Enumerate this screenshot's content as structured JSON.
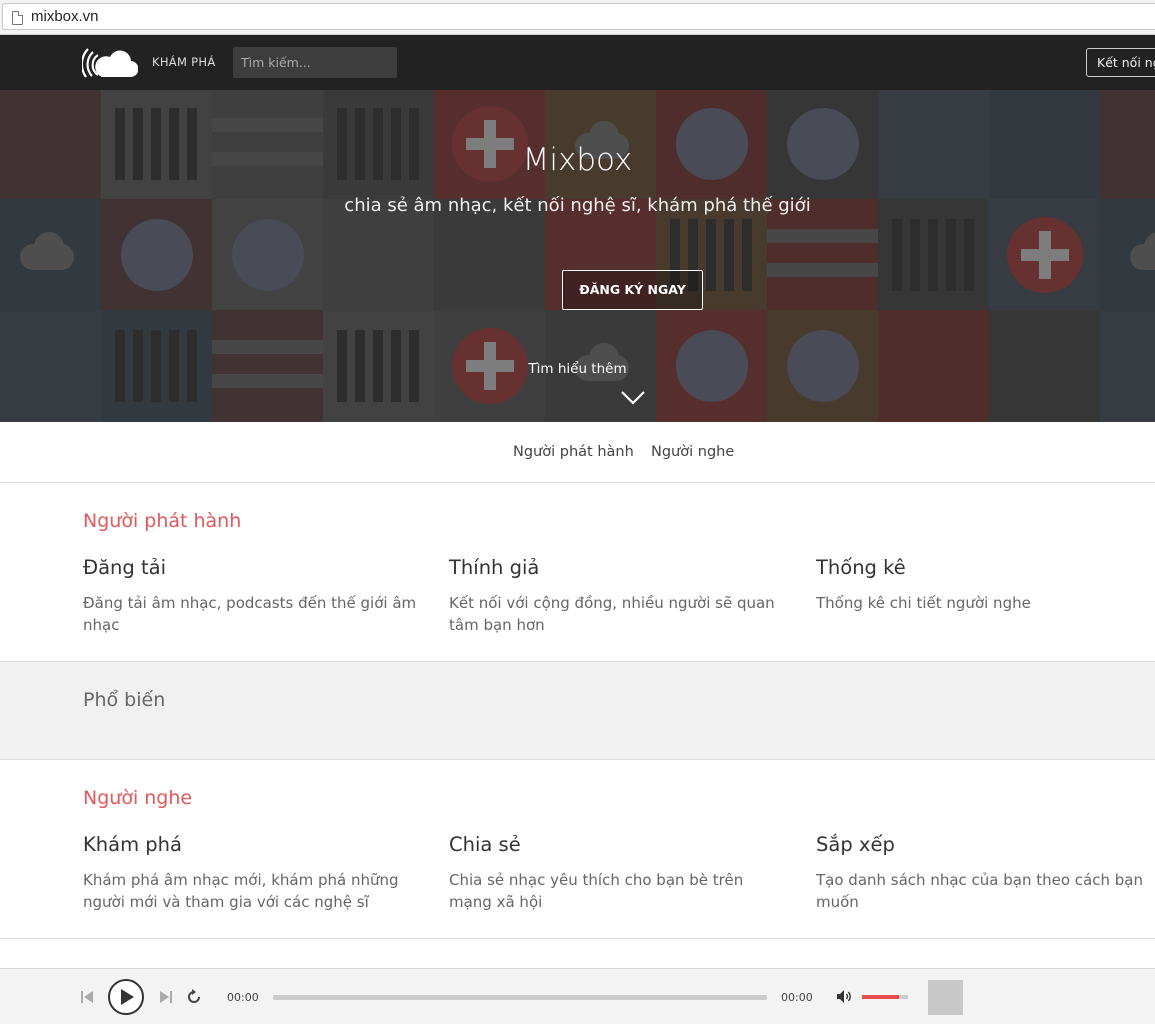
{
  "browser": {
    "url": "mixbox.vn"
  },
  "nav": {
    "explore": "KHÁM PHÁ",
    "search_placeholder": "Tìm kiếm...",
    "connect": "Kết nối ng"
  },
  "hero": {
    "title": "Mixbox",
    "subtitle": "chia sẻ âm nhạc, kết nối nghệ sĩ, khám phá thế giới",
    "signup": "ĐĂNG KÝ NGAY",
    "learn_more": "Tìm hiểu thêm"
  },
  "tabs": [
    "Người phát hành",
    "Người nghe"
  ],
  "publisher": {
    "heading": "Người phát hành",
    "features": [
      {
        "title": "Đăng tải",
        "desc": "Đăng tải âm nhạc, podcasts đến thế giới âm nhạc"
      },
      {
        "title": "Thính giả",
        "desc": "Kết nối với cộng đồng, nhiều người sẽ quan tâm bạn hơn"
      },
      {
        "title": "Thống kê",
        "desc": "Thống kê chi tiết người nghe"
      }
    ]
  },
  "popular": {
    "heading": "Phổ biến"
  },
  "listener": {
    "heading": "Người nghe",
    "features": [
      {
        "title": "Khám phá",
        "desc": "Khám phá âm nhạc mới, khám phá những người mới và tham gia với các nghệ sĩ"
      },
      {
        "title": "Chia sẻ",
        "desc": "Chia sẻ nhạc yêu thích cho bạn bè trên mạng xã hội"
      },
      {
        "title": "Sắp xếp",
        "desc": "Tạo danh sách nhạc của bạn theo cách bạn muốn"
      }
    ]
  },
  "player": {
    "current_time": "00:00",
    "duration": "00:00",
    "progress": 0,
    "volume": 0.8
  },
  "colors": {
    "accent": "#e0595c",
    "volume": "#e84b4b"
  }
}
